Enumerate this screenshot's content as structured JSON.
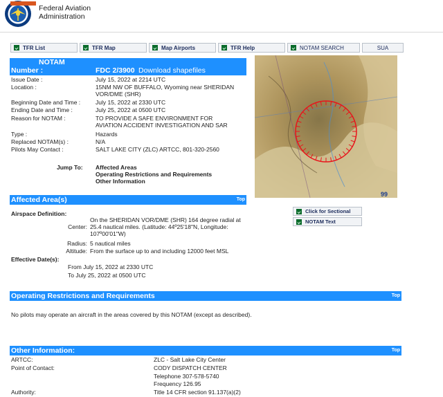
{
  "header": {
    "agency_line1": "Federal Aviation",
    "agency_line2": "Administration"
  },
  "nav": [
    {
      "label": "TFR List"
    },
    {
      "label": "TFR Map"
    },
    {
      "label": "Map Airports"
    },
    {
      "label": "TFR Help"
    },
    {
      "label": "NOTAM SEARCH"
    },
    {
      "label": "SUA"
    }
  ],
  "notam": {
    "title": "NOTAM",
    "number_label": "Number :",
    "number_value": "FDC 2/3900",
    "download_link": "Download shapefiles",
    "rows": [
      {
        "label": "Issue Date :",
        "value": "July 15, 2022 at 2214 UTC"
      },
      {
        "label": "Location :",
        "value": "15NM NW OF BUFFALO, Wyoming near SHERIDAN VOR/DME (SHR)"
      },
      {
        "label": "Beginning Date and Time :",
        "value": "July 15, 2022 at 2330 UTC"
      },
      {
        "label": "Ending Date and Time :",
        "value": "July 25, 2022 at 0500 UTC"
      },
      {
        "label": "Reason for NOTAM :",
        "value": "TO PROVIDE A SAFE ENVIRONMENT FOR AVIATION ACCIDENT INVESTIGATION AND SAR"
      },
      {
        "label": "Type :",
        "value": "Hazards"
      },
      {
        "label": "Replaced NOTAM(s) :",
        "value": "N/A"
      },
      {
        "label": "Pilots May Contact :",
        "value": "SALT LAKE CITY (ZLC) ARTCC, 801-320-2560"
      }
    ],
    "jump_label": "Jump To:",
    "jump_links": [
      "Affected Areas",
      "Operating Restrictions and Requirements",
      "Other Information"
    ]
  },
  "map": {
    "sectional_button": "Click for Sectional",
    "notam_text_button": "NOTAM Text",
    "chart_number": "99"
  },
  "affected": {
    "title": "Affected Area(s)",
    "top_link": "Top",
    "airspace_label": "Airspace Definition:",
    "center_label": "Center:",
    "center_value": "On the SHERIDAN VOR/DME (SHR) 164 degree radial at 25.4 nautical miles. (Latitude: 44º25'18\"N, Longitude: 107º00'01\"W)",
    "radius_label": "Radius:",
    "radius_value": "5 nautical miles",
    "altitude_label": "Altitude:",
    "altitude_value": "From the surface up to and including 12000 feet MSL",
    "effective_label": "Effective Date(s):",
    "from_text": "From July 15, 2022 at 2330 UTC",
    "to_text": "To July 25, 2022 at 0500 UTC"
  },
  "restrictions": {
    "title": "Operating Restrictions and Requirements",
    "top_link": "Top",
    "text": "No pilots may operate an aircraft in the areas covered by this NOTAM (except as described)."
  },
  "other": {
    "title": "Other Information:",
    "top_link": "Top",
    "artcc_label": "ARTCC:",
    "artcc_value": "ZLC - Salt Lake City Center",
    "poc_label": "Point of Contact:",
    "poc_line1": "CODY DISPATCH CENTER",
    "poc_line2": "Telephone 307-578-5740",
    "poc_line3": "Frequency 126.95",
    "authority_label": "Authority:",
    "authority_value": "Title 14 CFR section 91.137(a)(2)"
  },
  "colors": {
    "bar_blue": "#1e90ff",
    "button_green": "#0a6b2b",
    "map_circle": "#e8141b"
  }
}
